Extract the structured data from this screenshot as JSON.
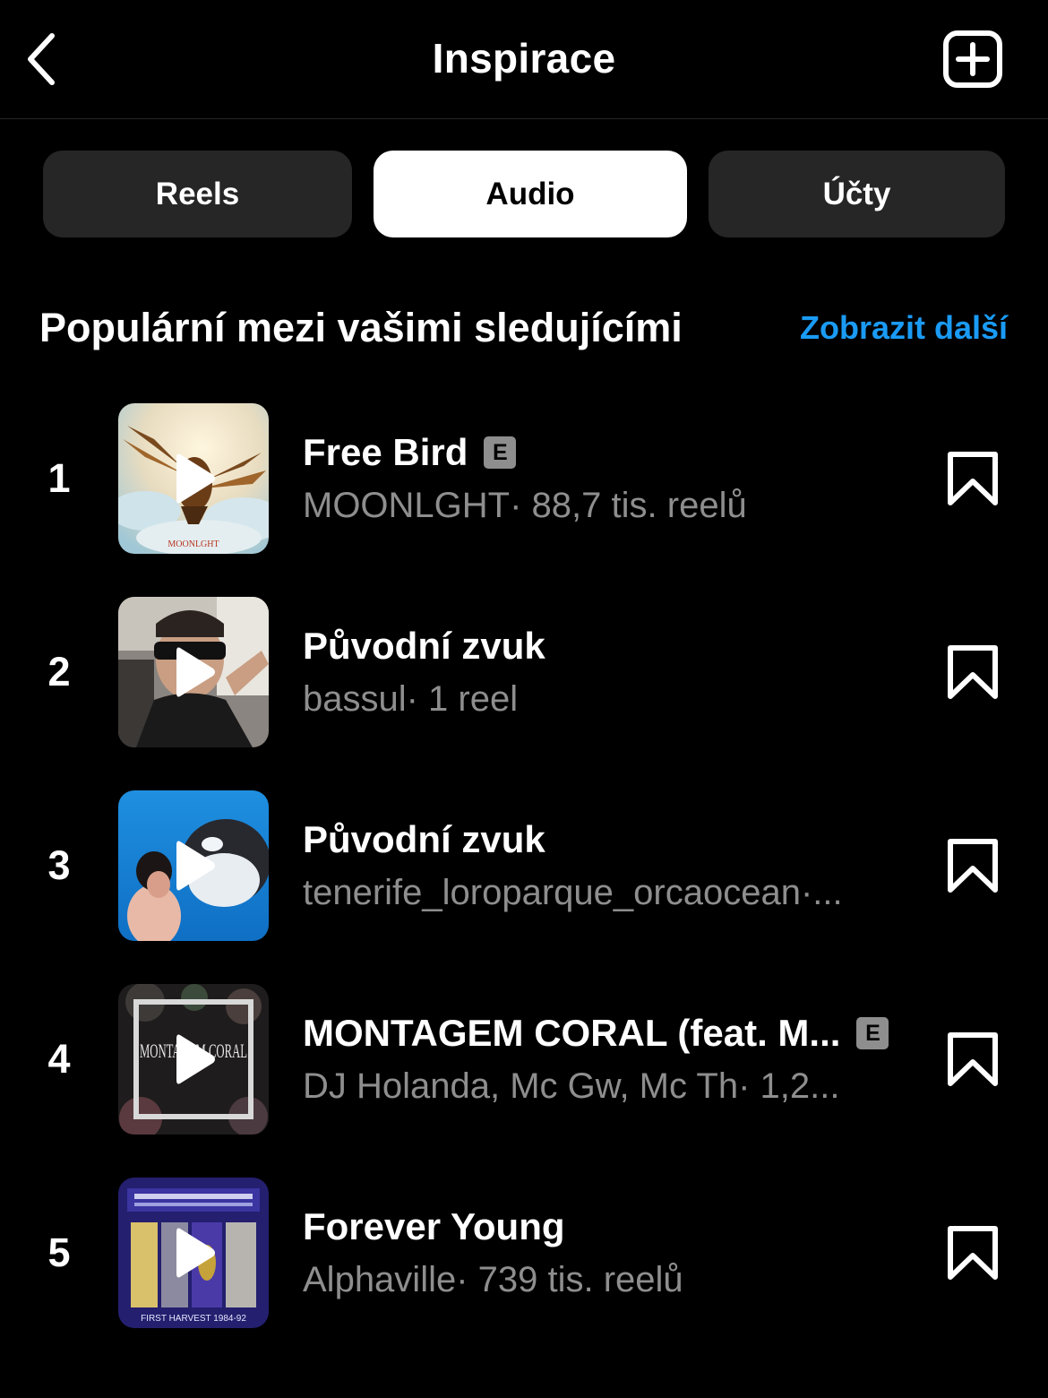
{
  "header": {
    "title": "Inspirace",
    "back_icon": "chevron-left-icon",
    "new_icon": "plus-square-icon"
  },
  "tabs": [
    {
      "label": "Reels",
      "active": false
    },
    {
      "label": "Audio",
      "active": true
    },
    {
      "label": "Účty",
      "active": false
    }
  ],
  "section": {
    "title": "Populární mezi vašimi sledujícími",
    "see_more": "Zobrazit další"
  },
  "tracks": [
    {
      "rank": "1",
      "title": "Free Bird",
      "explicit": "E",
      "artist": "MOONLGHT",
      "reels": " · 88,7 tis. reelů",
      "art_label": "MOONLGHT"
    },
    {
      "rank": "2",
      "title": "Původní zvuk",
      "explicit": "",
      "artist": "bassul",
      "reels": " · 1 reel",
      "art_label": ""
    },
    {
      "rank": "3",
      "title": "Původní zvuk",
      "explicit": "",
      "artist": "tenerife_loroparque_orcaocean",
      "reels": " ·...",
      "art_label": ""
    },
    {
      "rank": "4",
      "title": "MONTAGEM CORAL (feat. M...",
      "explicit": "E",
      "artist": "DJ Holanda, Mc Gw, Mc Th",
      "reels": " · 1,2...",
      "art_label": "MONTAGEM CORAL"
    },
    {
      "rank": "5",
      "title": "Forever Young",
      "explicit": "",
      "artist": "Alphaville",
      "reels": " · 739 tis. reelů",
      "art_label": "FIRST HARVEST 1984-92"
    }
  ],
  "colors": {
    "background": "#000000",
    "tab_inactive": "#262626",
    "tab_active": "#ffffff",
    "link": "#1a9bf5",
    "secondary_text": "#8e8e8e"
  }
}
